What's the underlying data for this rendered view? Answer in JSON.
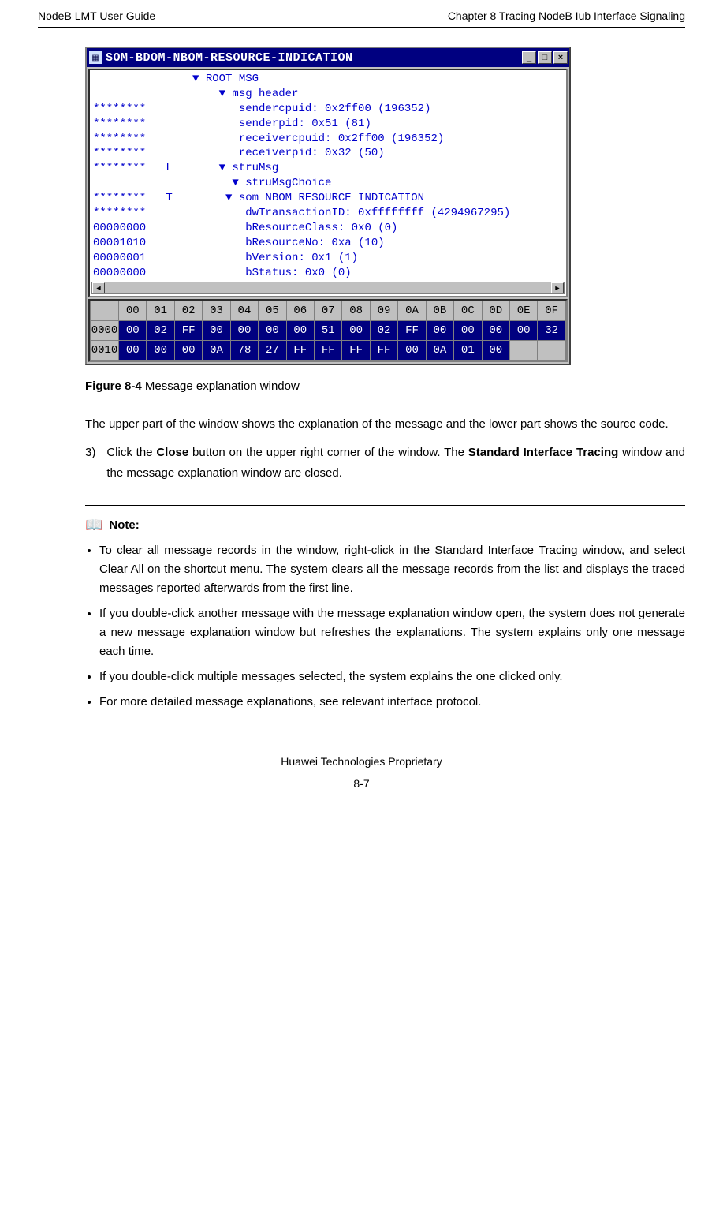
{
  "header": {
    "left": "NodeB LMT User Guide",
    "right": "Chapter 8  Tracing NodeB Iub Interface Signaling"
  },
  "window": {
    "title": "SOM-BDOM-NBOM-RESOURCE-INDICATION",
    "buttons": {
      "min": "_",
      "max": "□",
      "close": "×"
    },
    "msg_lines": [
      {
        "left": "",
        "indent": 15,
        "tri": true,
        "text": "ROOT MSG"
      },
      {
        "left": "",
        "indent": 19,
        "tri": true,
        "text": "msg header"
      },
      {
        "left": "********",
        "indent": 22,
        "tri": false,
        "text": "sendercpuid: 0x2ff00 (196352)"
      },
      {
        "left": "********",
        "indent": 22,
        "tri": false,
        "text": "senderpid: 0x51 (81)"
      },
      {
        "left": "********",
        "indent": 22,
        "tri": false,
        "text": "receivercpuid: 0x2ff00 (196352)"
      },
      {
        "left": "********",
        "indent": 22,
        "tri": false,
        "text": "receiverpid: 0x32 (50)"
      },
      {
        "left": "********   L",
        "indent": 19,
        "tri": true,
        "text": "struMsg"
      },
      {
        "left": "",
        "indent": 21,
        "tri": true,
        "text": "struMsgChoice"
      },
      {
        "left": "********   T",
        "indent": 20,
        "tri": true,
        "text": "som NBOM RESOURCE INDICATION"
      },
      {
        "left": "********",
        "indent": 23,
        "tri": false,
        "text": "dwTransactionID: 0xffffffff (4294967295)"
      },
      {
        "left": "00000000",
        "indent": 23,
        "tri": false,
        "text": "bResourceClass: 0x0 (0)"
      },
      {
        "left": "00001010",
        "indent": 23,
        "tri": false,
        "text": "bResourceNo: 0xa (10)"
      },
      {
        "left": "00000001",
        "indent": 23,
        "tri": false,
        "text": "bVersion: 0x1 (1)"
      },
      {
        "left": "00000000",
        "indent": 23,
        "tri": false,
        "text": "bStatus: 0x0 (0)"
      }
    ],
    "hex": {
      "cols": [
        "00",
        "01",
        "02",
        "03",
        "04",
        "05",
        "06",
        "07",
        "08",
        "09",
        "0A",
        "0B",
        "0C",
        "0D",
        "0E",
        "0F"
      ],
      "rows": [
        {
          "addr": "0000",
          "vals": [
            "00",
            "02",
            "FF",
            "00",
            "00",
            "00",
            "00",
            "51",
            "00",
            "02",
            "FF",
            "00",
            "00",
            "00",
            "00",
            "32"
          ]
        },
        {
          "addr": "0010",
          "vals": [
            "00",
            "00",
            "00",
            "0A",
            "78",
            "27",
            "FF",
            "FF",
            "FF",
            "FF",
            "00",
            "0A",
            "01",
            "00",
            "",
            ""
          ]
        }
      ]
    }
  },
  "caption": {
    "label": "Figure 8-4",
    "text": " Message explanation window"
  },
  "para1": "The upper part of the window shows the explanation of the message and the lower part shows the source code.",
  "step3": {
    "num": "3)",
    "text_a": "Click the ",
    "bold_a": "Close",
    "text_b": " button on the upper right corner of the window. The ",
    "bold_b": "Standard Interface Tracing",
    "text_c": " window and the message explanation window are closed."
  },
  "note": {
    "heading": "Note:",
    "items": [
      "To clear all message records in the window, right-click in the Standard Interface Tracing window, and select Clear All on the shortcut menu. The system clears all the message records from the list and displays the traced messages reported afterwards from the first line.",
      "If you double-click another message with the message explanation window open, the system does not generate a new message explanation window but refreshes the explanations. The system explains only one message each time.",
      "If you double-click multiple messages selected, the system explains the one clicked only.",
      "For more detailed message explanations, see relevant interface protocol."
    ]
  },
  "footer": {
    "line1": "Huawei Technologies Proprietary",
    "line2": "8-7"
  }
}
